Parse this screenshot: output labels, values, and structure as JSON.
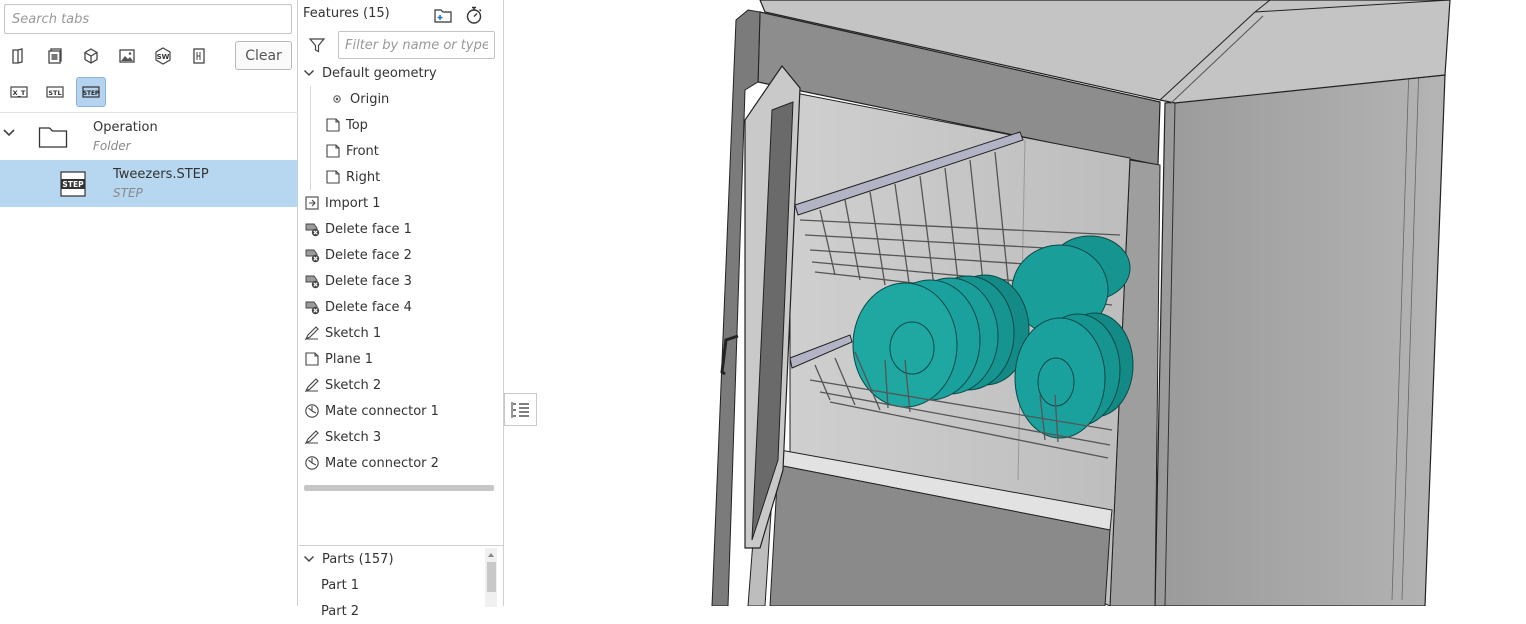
{
  "tabs_panel": {
    "search_placeholder": "Search tabs",
    "filter_icons": [
      "part-studio-icon",
      "assembly-icon",
      "part-icon",
      "image-icon",
      "solidworks-icon",
      "drawing-icon",
      "xt-icon",
      "stl-icon",
      "step-icon"
    ],
    "clear_label": "Clear",
    "folder": {
      "name": "Operation",
      "type": "Folder"
    },
    "file": {
      "name": "Tweezers.STEP",
      "type": "STEP"
    }
  },
  "features": {
    "title": "Features (15)",
    "filter_placeholder": "Filter by name or type",
    "default_geometry": "Default geometry",
    "items": [
      {
        "label": "Origin",
        "icon": "origin-icon"
      },
      {
        "label": "Top",
        "icon": "plane-icon"
      },
      {
        "label": "Front",
        "icon": "plane-icon"
      },
      {
        "label": "Right",
        "icon": "plane-icon"
      },
      {
        "label": "Import 1",
        "icon": "import-icon"
      },
      {
        "label": "Delete face 1",
        "icon": "delete-face-icon"
      },
      {
        "label": "Delete face 2",
        "icon": "delete-face-icon"
      },
      {
        "label": "Delete face 3",
        "icon": "delete-face-icon"
      },
      {
        "label": "Delete face 4",
        "icon": "delete-face-icon"
      },
      {
        "label": "Sketch 1",
        "icon": "sketch-icon"
      },
      {
        "label": "Plane 1",
        "icon": "plane-icon"
      },
      {
        "label": "Sketch 2",
        "icon": "sketch-icon"
      },
      {
        "label": "Mate connector 1",
        "icon": "mate-connector-icon"
      },
      {
        "label": "Sketch 3",
        "icon": "sketch-icon"
      },
      {
        "label": "Mate connector 2",
        "icon": "mate-connector-icon"
      }
    ]
  },
  "parts": {
    "title": "Parts (157)",
    "items": [
      "Part 1",
      "Part 2"
    ]
  },
  "colors": {
    "selection": "#b7d7f1",
    "plate_teal": "#1a9e9a",
    "cabinet_gray": "#a9a9a9"
  }
}
